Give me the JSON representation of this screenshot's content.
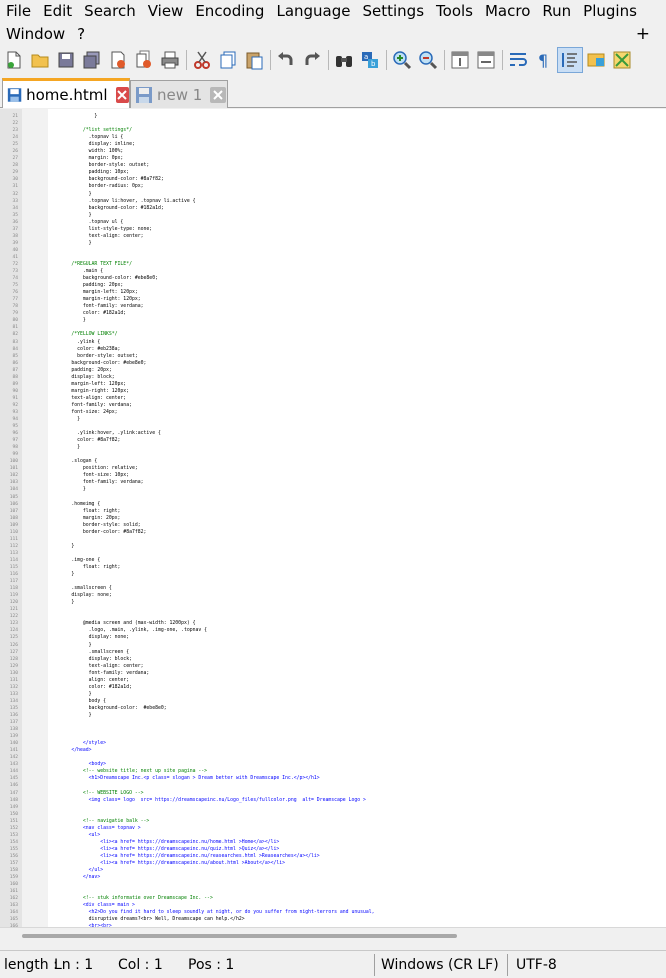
{
  "menu": {
    "row1": [
      "File",
      "Edit",
      "Search",
      "View",
      "Encoding",
      "Language",
      "Settings",
      "Tools",
      "Macro",
      "Run",
      "Plugins"
    ],
    "row2": [
      "Window",
      "?"
    ],
    "plus": "+"
  },
  "toolbar": {
    "buttons": [
      "new-file",
      "open-file",
      "save",
      "save-all",
      "close",
      "close-all",
      "print",
      "cut",
      "copy",
      "paste",
      "undo",
      "redo",
      "find",
      "replace",
      "zoom-in",
      "zoom-out",
      "sync-vertical",
      "sync-horizontal",
      "word-wrap",
      "show-all-characters",
      "indent-guide",
      "user-defined-language",
      "document-map"
    ]
  },
  "tabs": [
    {
      "label": "home.html",
      "active": true
    },
    {
      "label": "new 1",
      "active": false
    }
  ],
  "editor": {
    "lines": [
      {
        "n": "21",
        "t": "              }"
      },
      {
        "n": "22",
        "t": ""
      },
      {
        "n": "23",
        "t": "          /*list settings*/"
      },
      {
        "n": "24",
        "t": "            .topnav li {"
      },
      {
        "n": "25",
        "t": "            display: inline;"
      },
      {
        "n": "26",
        "t": "            width: 100%;"
      },
      {
        "n": "27",
        "t": "            margin: 0px;"
      },
      {
        "n": "28",
        "t": "            border-style: outset;"
      },
      {
        "n": "29",
        "t": "            padding: 10px;"
      },
      {
        "n": "30",
        "t": "            background-color: #8a7f82;"
      },
      {
        "n": "31",
        "t": "            border-radius: 0px;"
      },
      {
        "n": "32",
        "t": "            }"
      },
      {
        "n": "33",
        "t": "            .topnav li:hover, .topnav li.active {"
      },
      {
        "n": "34",
        "t": "            background-color: #182a1d;"
      },
      {
        "n": "35",
        "t": "            }"
      },
      {
        "n": "36",
        "t": "            .topnav ul {"
      },
      {
        "n": "37",
        "t": "            list-style-type: none;"
      },
      {
        "n": "38",
        "t": "            text-align: center;"
      },
      {
        "n": "39",
        "t": "            }"
      },
      {
        "n": "40",
        "t": ""
      },
      {
        "n": "41",
        "t": ""
      },
      {
        "n": "72",
        "t": "      /*REGULAR TEXT FILE*/"
      },
      {
        "n": "73",
        "t": "          .main {"
      },
      {
        "n": "74",
        "t": "          background-color: #ebe8e0;"
      },
      {
        "n": "75",
        "t": "          padding: 20px;"
      },
      {
        "n": "76",
        "t": "          margin-left: 120px;"
      },
      {
        "n": "77",
        "t": "          margin-right: 120px;"
      },
      {
        "n": "78",
        "t": "          font-family: verdana;"
      },
      {
        "n": "79",
        "t": "          color: #182a1d;"
      },
      {
        "n": "80",
        "t": "          }"
      },
      {
        "n": "81",
        "t": ""
      },
      {
        "n": "82",
        "t": "      /*YELLOW LINKS*/"
      },
      {
        "n": "83",
        "t": "        .ylink {"
      },
      {
        "n": "84",
        "t": "        color: #eb238a;"
      },
      {
        "n": "85",
        "t": "        border-style: outset;"
      },
      {
        "n": "86",
        "t": "      background-color: #ebe8e0;"
      },
      {
        "n": "87",
        "t": "      padding: 20px;"
      },
      {
        "n": "88",
        "t": "      display: block;"
      },
      {
        "n": "89",
        "t": "      margin-left: 120px;"
      },
      {
        "n": "90",
        "t": "      margin-right: 120px;"
      },
      {
        "n": "91",
        "t": "      text-align: center;"
      },
      {
        "n": "92",
        "t": "      font-family: verdana;"
      },
      {
        "n": "93",
        "t": "      font-size: 24px;"
      },
      {
        "n": "94",
        "t": "        }"
      },
      {
        "n": "95",
        "t": ""
      },
      {
        "n": "96",
        "t": "        .ylink:hover, .ylink:active {"
      },
      {
        "n": "97",
        "t": "        color: #8a7f82;"
      },
      {
        "n": "98",
        "t": "        }"
      },
      {
        "n": "99",
        "t": ""
      },
      {
        "n": "100",
        "t": "      .slogan {"
      },
      {
        "n": "101",
        "t": "          position: relative;"
      },
      {
        "n": "102",
        "t": "          font-size: 10px;"
      },
      {
        "n": "103",
        "t": "          font-family: verdana;"
      },
      {
        "n": "104",
        "t": "          }"
      },
      {
        "n": "105",
        "t": ""
      },
      {
        "n": "106",
        "t": "      .homeimg {"
      },
      {
        "n": "107",
        "t": "          float: right;"
      },
      {
        "n": "108",
        "t": "          margin: 20px;"
      },
      {
        "n": "109",
        "t": "          border-style: solid;"
      },
      {
        "n": "110",
        "t": "          border-color: #8a7f82;"
      },
      {
        "n": "111",
        "t": ""
      },
      {
        "n": "112",
        "t": "      }"
      },
      {
        "n": "113",
        "t": ""
      },
      {
        "n": "114",
        "t": "      .img-one {"
      },
      {
        "n": "115",
        "t": "          float: right;"
      },
      {
        "n": "116",
        "t": "      }"
      },
      {
        "n": "117",
        "t": ""
      },
      {
        "n": "118",
        "t": "      .smallscreen {"
      },
      {
        "n": "119",
        "t": "      display: none;"
      },
      {
        "n": "120",
        "t": "      }"
      },
      {
        "n": "121",
        "t": ""
      },
      {
        "n": "122",
        "t": ""
      },
      {
        "n": "123",
        "t": "          @media screen and (max-width: 1200px) {"
      },
      {
        "n": "124",
        "t": "            .logo, .main, .ylink, .img-one, .topnav {"
      },
      {
        "n": "125",
        "t": "            display: none;"
      },
      {
        "n": "126",
        "t": "            }"
      },
      {
        "n": "127",
        "t": "            .smallscreen {"
      },
      {
        "n": "128",
        "t": "            display: block;"
      },
      {
        "n": "129",
        "t": "            text-align: center;"
      },
      {
        "n": "130",
        "t": "            font-family: verdana;"
      },
      {
        "n": "131",
        "t": "            align: center;"
      },
      {
        "n": "132",
        "t": "            color: #182a1d;"
      },
      {
        "n": "133",
        "t": "            }"
      },
      {
        "n": "134",
        "t": "            body {"
      },
      {
        "n": "135",
        "t": "            background-color:  #ebe8e0;"
      },
      {
        "n": "136",
        "t": "            }"
      },
      {
        "n": "137",
        "t": ""
      },
      {
        "n": "138",
        "t": ""
      },
      {
        "n": "139",
        "t": ""
      },
      {
        "n": "140",
        "t": "          </style>"
      },
      {
        "n": "141",
        "t": "      </head>"
      },
      {
        "n": "142",
        "t": ""
      },
      {
        "n": "143",
        "t": "            <body>"
      },
      {
        "n": "144",
        "t": "          <!-- website title; next up site pagina -->"
      },
      {
        "n": "145",
        "t": "            <h1>Dreamscape Inc.<p class= slogan > Dream better with Dreamscape Inc.</p></h1>"
      },
      {
        "n": "146",
        "t": ""
      },
      {
        "n": "147",
        "t": "          <!-- WEBSITE LOGO -->"
      },
      {
        "n": "148",
        "t": "            <img class= logo  src= https://dreamscapeinc.nu/Logo_files/fullcolor.png  alt= Dreamscape Logo >"
      },
      {
        "n": "149",
        "t": ""
      },
      {
        "n": "150",
        "t": ""
      },
      {
        "n": "151",
        "t": "          <!-- navigatie balk -->"
      },
      {
        "n": "152",
        "t": "          <nav class= topnav >"
      },
      {
        "n": "153",
        "t": "            <ul>"
      },
      {
        "n": "154",
        "t": "                <li><a href= https://dreamscapeinc.nu/home.html >Home</a></li>"
      },
      {
        "n": "155",
        "t": "                <li><a href= https://dreamscapeinc.nu/quiz.html >Quiz</a></li>"
      },
      {
        "n": "156",
        "t": "                <li><a href= https://dreamscapeinc.nu/reasearches.html >Reasearches</a></li>"
      },
      {
        "n": "157",
        "t": "                <li><a href= https://dreamscapeinc.nu/about.html >About</a></li>"
      },
      {
        "n": "158",
        "t": "            </ul>"
      },
      {
        "n": "159",
        "t": "          </nav>"
      },
      {
        "n": "160",
        "t": ""
      },
      {
        "n": "161",
        "t": ""
      },
      {
        "n": "162",
        "t": "          <!-- stuk informatie over Dreamscape Inc. -->"
      },
      {
        "n": "163",
        "t": "          <div class= main >"
      },
      {
        "n": "164",
        "t": "            <h2>Do you find it hard to sleep soundly at night, or do you suffer from night-terrors and unusual,"
      },
      {
        "n": "165",
        "t": "            disruptive dreams?<br> Well, Dreamscape can help.</h2>"
      },
      {
        "n": "166",
        "t": "            <br><br>"
      }
    ]
  },
  "scrollbar": {
    "thumb_fraction": 0.7
  },
  "status": {
    "length": "length :",
    "ln": "Ln : 1",
    "col": "Col : 1",
    "pos": "Pos : 1",
    "eol": "Windows (CR LF)",
    "encoding": "UTF-8"
  }
}
